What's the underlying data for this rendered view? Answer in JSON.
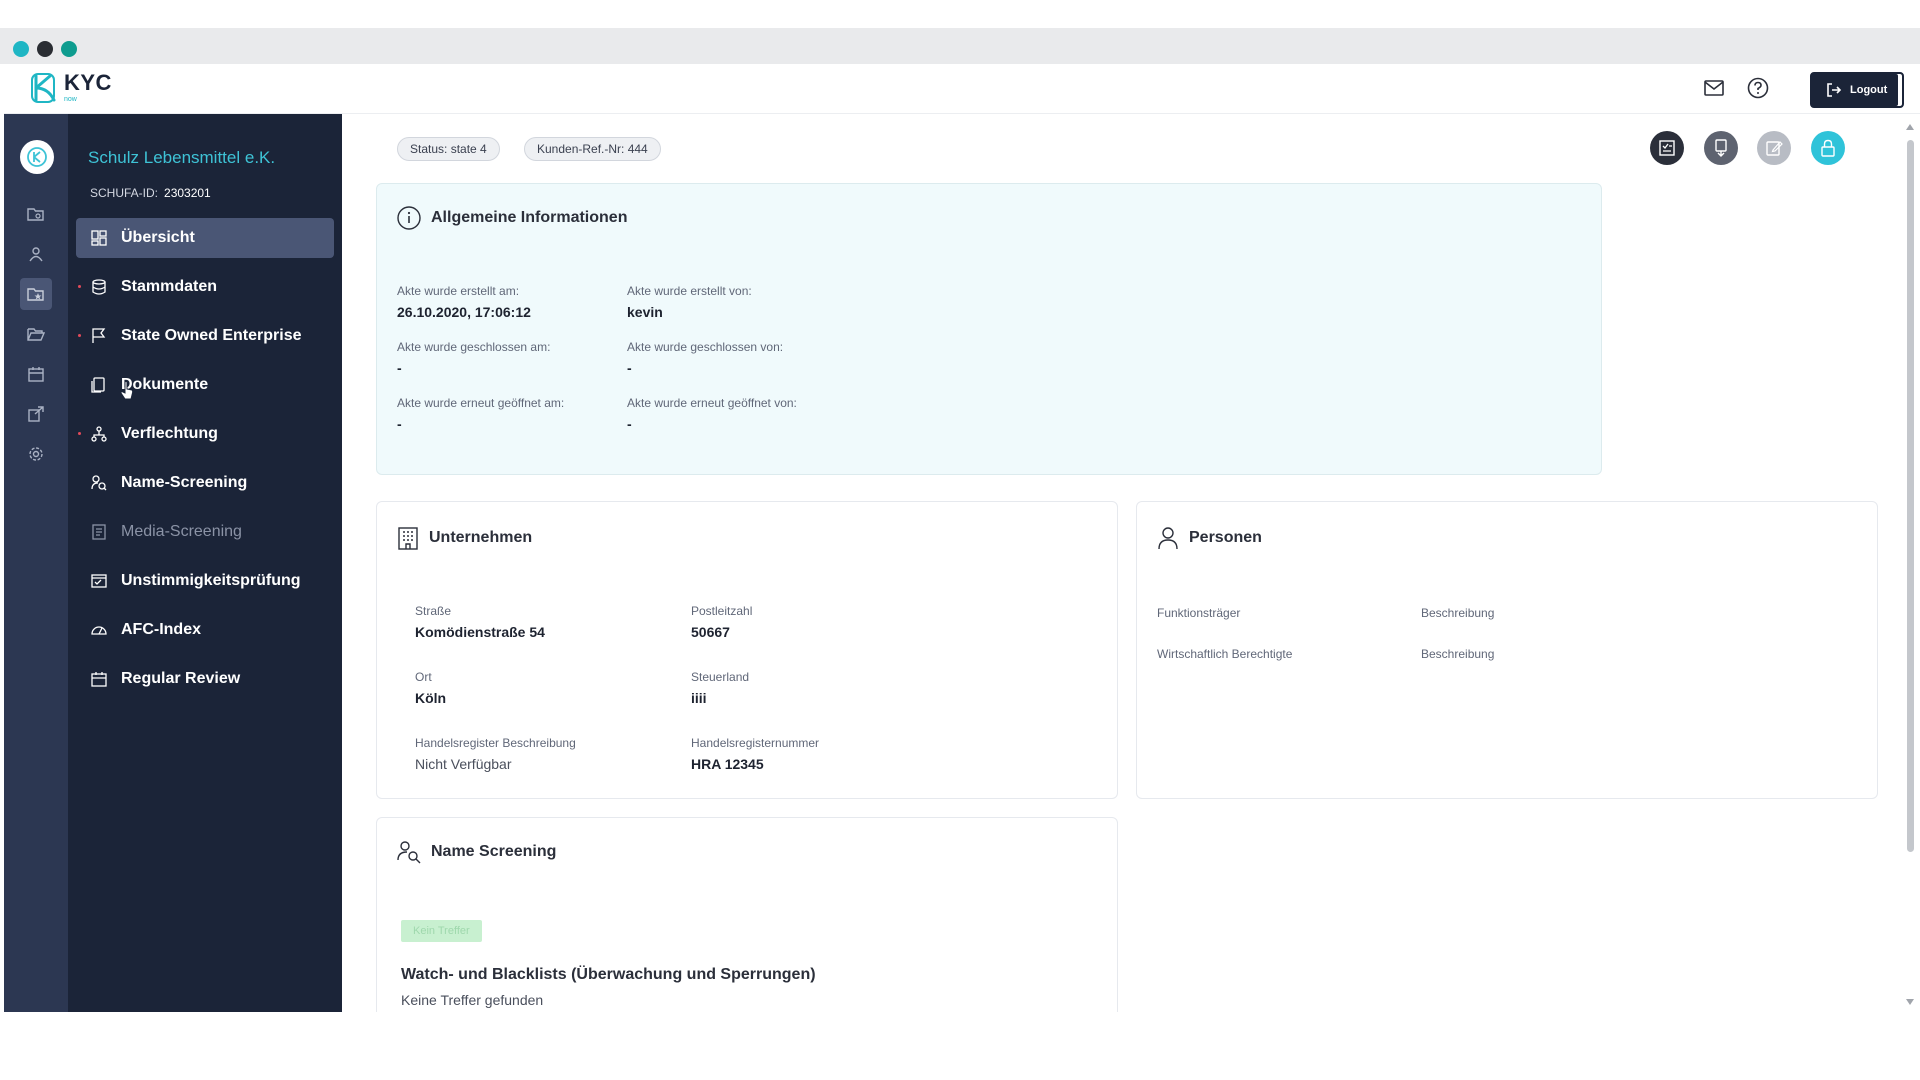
{
  "app": {
    "logo_text": "KYC",
    "logo_sub": "now",
    "logout_label": "Logout"
  },
  "sidebar": {
    "company_name": "Schulz Lebensmittel e.K.",
    "schufa_label": "SCHUFA-ID:",
    "schufa_id": "2303201",
    "items": [
      {
        "label": "Übersicht",
        "icon": "dashboard-icon",
        "active": true,
        "bullet": false
      },
      {
        "label": "Stammdaten",
        "icon": "database-icon",
        "active": false,
        "bullet": true
      },
      {
        "label": "State Owned Enterprise",
        "icon": "flag-icon",
        "active": false,
        "bullet": true
      },
      {
        "label": "Dokumente",
        "icon": "document-icon",
        "active": false,
        "bullet": false
      },
      {
        "label": "Verflechtung",
        "icon": "network-icon",
        "active": false,
        "bullet": true
      },
      {
        "label": "Name-Screening",
        "icon": "person-search-icon",
        "active": false,
        "bullet": false
      },
      {
        "label": "Media-Screening",
        "icon": "media-icon",
        "active": false,
        "bullet": false,
        "disabled": true
      },
      {
        "label": "Unstimmigkeitsprüfung",
        "icon": "check-window-icon",
        "active": false,
        "bullet": false
      },
      {
        "label": "AFC-Index",
        "icon": "gauge-icon",
        "active": false,
        "bullet": false
      },
      {
        "label": "Regular Review",
        "icon": "calendar-icon",
        "active": false,
        "bullet": false
      }
    ]
  },
  "header": {
    "status_pill": "Status: state 4",
    "ref_pill": "Kunden-Ref.-Nr: 444"
  },
  "info_card": {
    "title": "Allgemeine Informationen",
    "fields": [
      {
        "label": "Akte wurde erstellt am:",
        "value": "26.10.2020, 17:06:12"
      },
      {
        "label": "Akte wurde erstellt von:",
        "value": "kevin"
      },
      {
        "label": "Akte wurde geschlossen am:",
        "value": "-"
      },
      {
        "label": "Akte wurde geschlossen von:",
        "value": "-"
      },
      {
        "label": "Akte wurde erneut geöffnet am:",
        "value": "-"
      },
      {
        "label": "Akte wurde erneut geöffnet von:",
        "value": "-"
      }
    ]
  },
  "company_card": {
    "title": "Unternehmen",
    "fields": [
      {
        "label": "Straße",
        "value": "Komödienstraße 54"
      },
      {
        "label": "Postleitzahl",
        "value": "50667"
      },
      {
        "label": "Ort",
        "value": "Köln"
      },
      {
        "label": "Steuerland",
        "value": "iiii"
      },
      {
        "label": "Handelsregister Beschreibung",
        "value": "Nicht Verfügbar"
      },
      {
        "label": "Handelsregisternummer",
        "value": "HRA 12345"
      }
    ]
  },
  "persons_card": {
    "title": "Personen",
    "rows": [
      {
        "label": "Funktionsträger",
        "value": "Beschreibung"
      },
      {
        "label": "Wirtschaftlich Berechtigte",
        "value": "Beschreibung"
      }
    ]
  },
  "screening_card": {
    "title": "Name Screening",
    "badge": "Kein Treffer",
    "section_title": "Watch- und Blacklists (Überwachung und Sperrungen)",
    "section_text": "Keine Treffer gefunden"
  },
  "colors": {
    "sidebar_bg": "#1b2438",
    "rail_bg": "#2c3752",
    "accent": "#3ec3d6",
    "info_card_bg": "#f0fafc"
  }
}
